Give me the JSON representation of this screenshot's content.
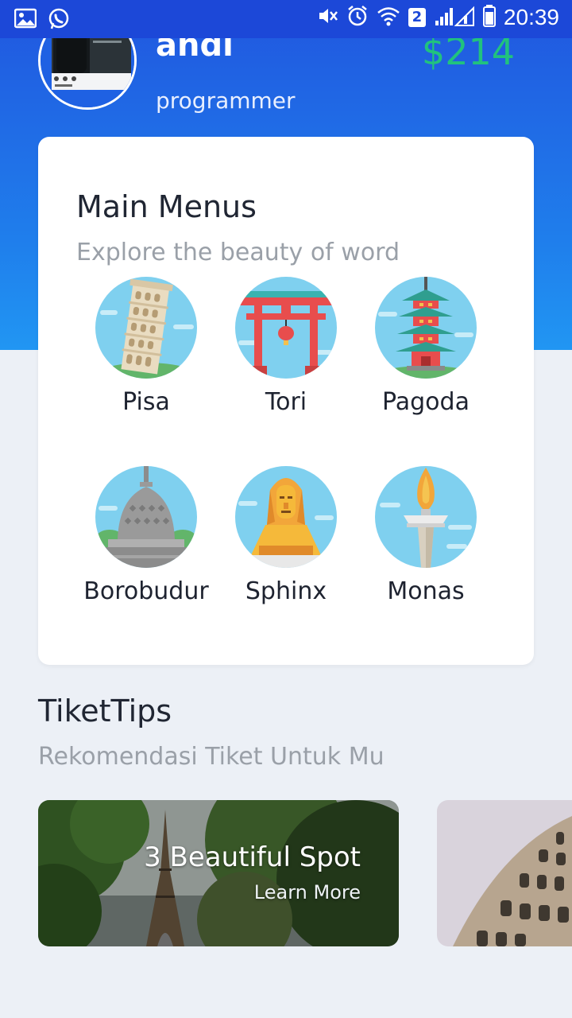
{
  "status_bar": {
    "time": "20:39",
    "sim_number": "2"
  },
  "profile": {
    "name": "andi",
    "role": "programmer",
    "balance": "$214"
  },
  "main_menu": {
    "title": "Main Menus",
    "subtitle": "Explore the beauty of word",
    "items": [
      {
        "label": "Pisa",
        "icon": "leaning-tower-icon"
      },
      {
        "label": "Tori",
        "icon": "torii-gate-icon"
      },
      {
        "label": "Pagoda",
        "icon": "pagoda-icon"
      },
      {
        "label": "Borobudur",
        "icon": "borobudur-stupa-icon"
      },
      {
        "label": "Sphinx",
        "icon": "sphinx-icon"
      },
      {
        "label": "Monas",
        "icon": "monas-monument-icon"
      }
    ]
  },
  "tiket_tips": {
    "title": "TiketTips",
    "subtitle": "Rekomendasi Tiket Untuk Mu",
    "cards": [
      {
        "title": "3 Beautiful Spot",
        "link": "Learn More"
      }
    ]
  },
  "colors": {
    "header_top": "#2156df",
    "header_bottom": "#2196f3",
    "balance_green": "#21c27e",
    "page_background": "#ecf0f6"
  }
}
